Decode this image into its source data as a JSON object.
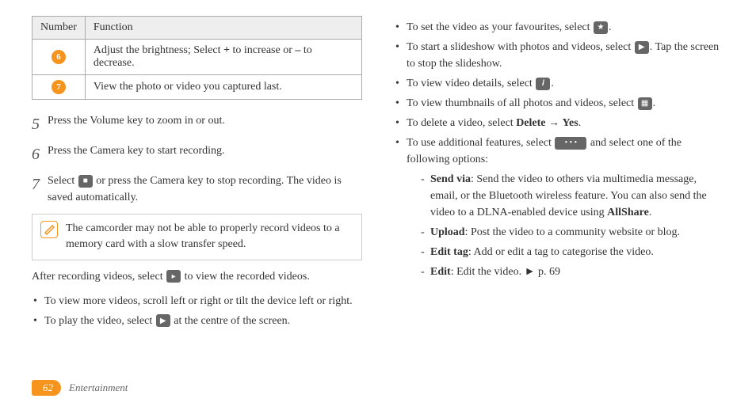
{
  "table": {
    "header_number": "Number",
    "header_function": "Function",
    "rows": [
      {
        "num": "6",
        "func_pre": "Adjust the brightness; Select ",
        "bold1": "+",
        "func_mid": " to increase or ",
        "bold2": "–",
        "func_post": " to decrease."
      },
      {
        "num": "7",
        "func": "View the photo or video you captured last."
      }
    ]
  },
  "steps": [
    {
      "num": "5",
      "text": "Press the Volume key to zoom in or out."
    },
    {
      "num": "6",
      "text": "Press the Camera key to start recording."
    },
    {
      "num": "7",
      "text_pre": "Select ",
      "text_post": " or press the Camera key to stop recording. The video is saved automatically."
    }
  ],
  "note": {
    "text": "The camcorder may not be able to properly record videos to a memory card with a slow transfer speed."
  },
  "after_para_pre": "After recording videos, select ",
  "after_para_post": " to view the recorded videos.",
  "left_bullets": [
    {
      "text": "To view more videos, scroll left or right or tilt the device left or right."
    },
    {
      "pre": "To play the video, select ",
      "post": " at the centre of the screen."
    }
  ],
  "right_bullets": [
    {
      "pre": "To set the video as your favourites, select ",
      "post": ".",
      "icon": "star"
    },
    {
      "pre": "To start a slideshow with photos and videos, select ",
      "post": ". Tap the screen to stop the slideshow.",
      "icon": "play"
    },
    {
      "pre": "To view video details, select ",
      "post": ".",
      "icon": "info"
    },
    {
      "pre": "To view thumbnails of all photos and videos, select ",
      "post": ".",
      "icon": "grid"
    },
    {
      "pre": "To delete a video, select ",
      "bold1": "Delete",
      "mid": " → ",
      "bold2": "Yes",
      "post": "."
    },
    {
      "pre": "To use additional features, select ",
      "post": " and select one of the following options:",
      "icon": "more"
    }
  ],
  "dashes": [
    {
      "bold": "Send via",
      "pre": ": Send the video to others via multimedia message, email, or the Bluetooth wireless feature. You can also send the video to a DLNA-enabled device using ",
      "bold2": "AllShare",
      "post": "."
    },
    {
      "bold": "Upload",
      "text": ": Post the video to a community website or blog."
    },
    {
      "bold": "Edit tag",
      "text": ": Add or edit a tag to categorise the video."
    },
    {
      "bold": "Edit",
      "text": ": Edit the video. ► p. 69"
    }
  ],
  "footer": {
    "page": "62",
    "section": "Entertainment"
  },
  "icons": {
    "stop": "■",
    "forward": "▸",
    "play": "▶",
    "star": "★",
    "info": "𝒊",
    "grid": "▦",
    "more": "• • •"
  }
}
